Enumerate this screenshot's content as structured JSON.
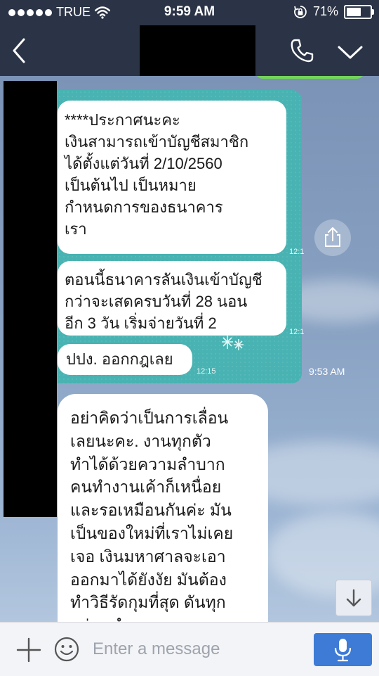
{
  "status_bar": {
    "carrier": "TRUE",
    "time": "9:59 AM",
    "battery_percent": "71%",
    "battery_level": 0.71
  },
  "header": {
    "icons": [
      "back-chevron-icon",
      "phone-icon",
      "chevron-down-icon"
    ]
  },
  "messages": [
    {
      "lines": [
        "****ประกาศนะคะ",
        "เงินสามารถเข้าบัญชีสมาชิก",
        "ได้ตั้งแต่วันที่  2/10/2560",
        "เป็นต้นไป  เป็นหมาย",
        "กำหนดการของธนาคาร",
        "เรา"
      ],
      "time": "12:1"
    },
    {
      "lines": [
        "ตอนนี้ธนาคารลันเงินเข้าบัญชี",
        "กว่าจะเสดครบวันที่ 28 นอน",
        "อีก 3 วัน เริ่มจ่ายวันที่ 2"
      ],
      "time": "12:1"
    },
    {
      "lines": [
        "ปปง. ออกกฎเลย"
      ],
      "time": "12:15"
    }
  ],
  "shared_image_time": "9:53 AM",
  "text_message": {
    "lines": [
      "อย่าคิดว่าเป็นการเลื่อน",
      "เลยนะคะ. งานทุกตัว",
      "ทำได้ด้วยความลำบาก",
      "คนทำงานเค้าก็เหนื่อย",
      "และรอเหมือนกันค่ะ มัน",
      "เป็นของใหม่ที่เราไม่เคย",
      "เจอ เงินมหาศาลจะเอา",
      "ออกมาได้ยังงัย มันต้อง",
      "ทำวิธีรัดกุมที่สุด ดันทุก",
      "อย่าง ทำทุกทาง"
    ]
  },
  "composer": {
    "placeholder": "Enter a message"
  },
  "colors": {
    "header_bg": "#2b3446",
    "shared_image_bg": "#48b3b2",
    "send_button": "#3e7bd6",
    "chat_bg": "#8aa3c3"
  }
}
